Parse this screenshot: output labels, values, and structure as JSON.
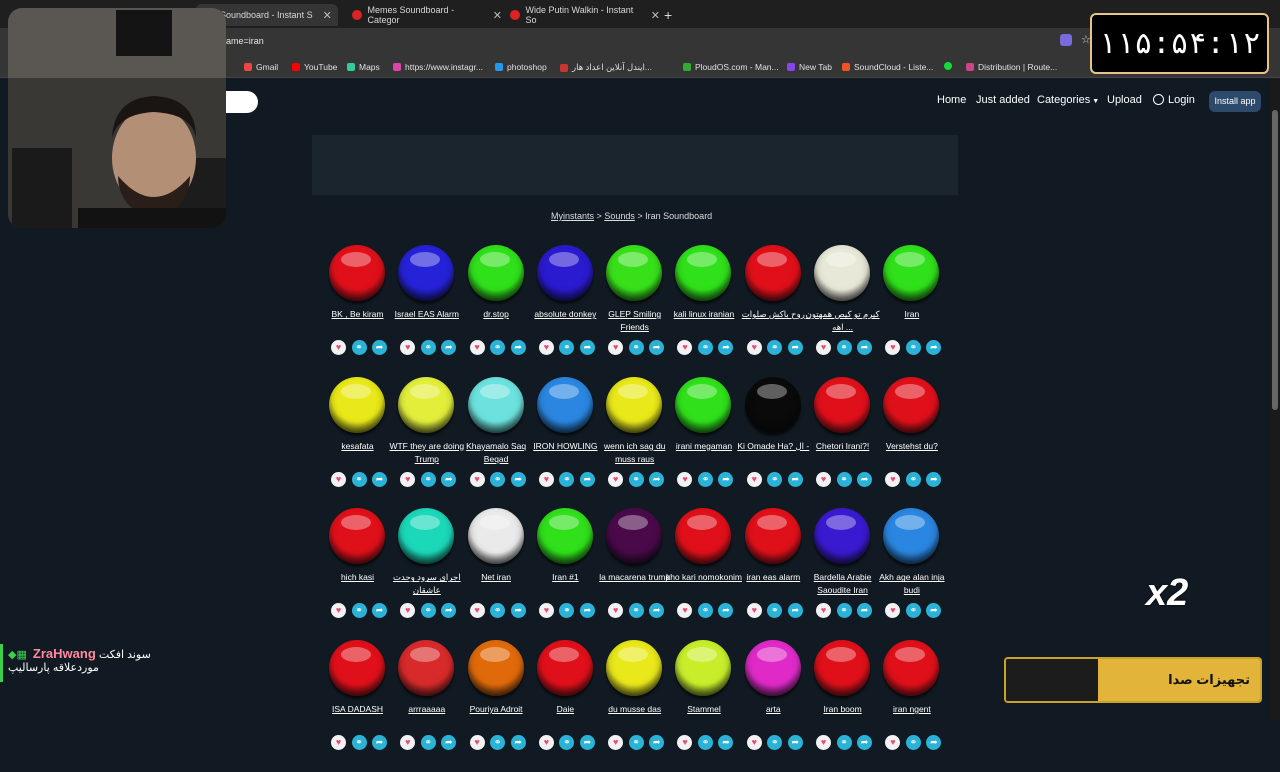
{
  "browser": {
    "tabs": [
      {
        "label": "Iran Soundboard - Instant S"
      },
      {
        "label": "Memes Soundboard - Categor"
      },
      {
        "label": "Wide Putin Walkin - Instant So"
      }
    ],
    "url": "ame=iran",
    "bookmarks": [
      "Gmail",
      "YouTube",
      "Maps",
      "https://www.instagr...",
      "photoshop",
      "ایندل آنلاین اعداد هار...",
      "PloudOS.com - Man...",
      "New Tab",
      "SoundCloud - Liste...",
      "Distribution | Route..."
    ]
  },
  "site_nav": {
    "home": "Home",
    "just_added": "Just added",
    "categories": "Categories",
    "upload": "Upload",
    "login": "Login",
    "install": "Install app"
  },
  "breadcrumb": {
    "root": "Myinstants",
    "sounds": "Sounds",
    "sep": ">",
    "current": "Iran Soundboard"
  },
  "sounds": [
    {
      "label": "BK , Be kiram",
      "color": "#e0101a"
    },
    {
      "label": "Israel EAS Alarm",
      "color": "#2622d8"
    },
    {
      "label": "dr.stop",
      "color": "#2fe01a"
    },
    {
      "label": "absolute donkey",
      "color": "#2a1ad0"
    },
    {
      "label": "GLEP Smiling Friends",
      "color": "#38e01a"
    },
    {
      "label": "kali linux iranian",
      "color": "#2fe01a"
    },
    {
      "label": "روح باکش صلوات",
      "color": "#e0101a"
    },
    {
      "label": "کیرم تو کیص همهتون ... اهه",
      "color": "#e8e8d8"
    },
    {
      "label": "Iran",
      "color": "#2fe01a"
    },
    {
      "label": "kesafata",
      "color": "#e8e81a"
    },
    {
      "label": "WTF they are doing Trump",
      "color": "#e2ee3a"
    },
    {
      "label": "Khayamalo Saq Beqad",
      "color": "#6ce2de"
    },
    {
      "label": "IRON HOWLING",
      "color": "#2a86e0"
    },
    {
      "label": "wenn ich sag du muss raus",
      "color": "#e8e81a"
    },
    {
      "label": "irani megaman",
      "color": "#2fe01a"
    },
    {
      "label": "Ki Omade Ha? ال -",
      "color": "#0a0a0a"
    },
    {
      "label": "Chetori Irani?!",
      "color": "#e0101a"
    },
    {
      "label": "Verstehst du?",
      "color": "#e0101a"
    },
    {
      "label": "hich kasi",
      "color": "#e0101a"
    },
    {
      "label": "اجرای سرود وحدت عاشقان",
      "color": "#1ad8b8"
    },
    {
      "label": "Net iran",
      "color": "#eaeaea"
    },
    {
      "label": "Iran #1",
      "color": "#2fe01a"
    },
    {
      "label": "la macarena trump",
      "color": "#4a0a4a"
    },
    {
      "label": "kho kari nomokonim",
      "color": "#e0101a"
    },
    {
      "label": "iran eas alarm",
      "color": "#e0101a"
    },
    {
      "label": "Bardella Arabie Saoudite Iran",
      "color": "#3a1ad0"
    },
    {
      "label": "Akh age alan inja budi",
      "color": "#2a86e0"
    },
    {
      "label": "ISA DADASH",
      "color": "#e0101a"
    },
    {
      "label": "arrraaaaa",
      "color": "#d82a2a"
    },
    {
      "label": "Pouriya Adroit",
      "color": "#e06a0a"
    },
    {
      "label": "Daie",
      "color": "#e0101a"
    },
    {
      "label": "du musse das",
      "color": "#e8e81a"
    },
    {
      "label": "Stammel",
      "color": "#c8ee2a"
    },
    {
      "label": "arta",
      "color": "#e02ac8"
    },
    {
      "label": "Iran boom",
      "color": "#e0101a"
    },
    {
      "label": "iran ngent",
      "color": "#e0101a"
    }
  ],
  "overlay": {
    "timer": "۱۱۵:۵۴:۱۲",
    "multiplier": "x2",
    "chat_user": "ZraHwang",
    "chat_line1": "سوند افکت",
    "chat_line2": "موردعلاقه پارسالیپ",
    "banner_text": "تجهیزات صدا"
  }
}
